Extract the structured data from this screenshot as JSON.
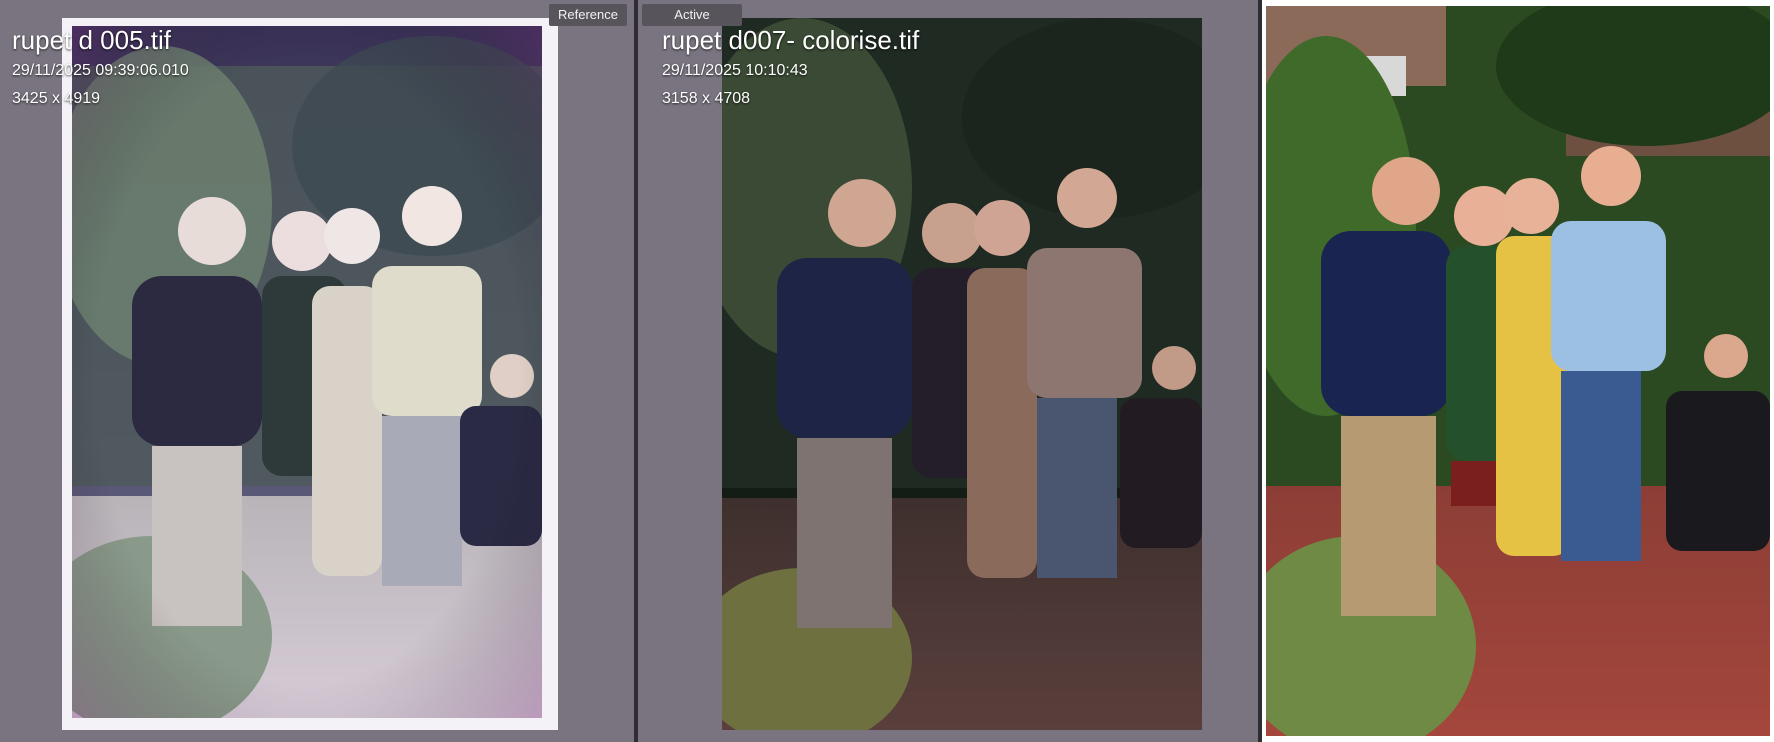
{
  "panels": {
    "reference": {
      "tab_label": "Reference",
      "filename": "rupet d 005.tif",
      "datetime": "29/11/2025 09:39:06.010",
      "dimensions": "3425 x 4919"
    },
    "active": {
      "tab_label": "Active",
      "filename": "rupet d007-  colorise.tif",
      "datetime": "29/11/2025 10:10:43",
      "dimensions": "3158 x 4708"
    }
  }
}
